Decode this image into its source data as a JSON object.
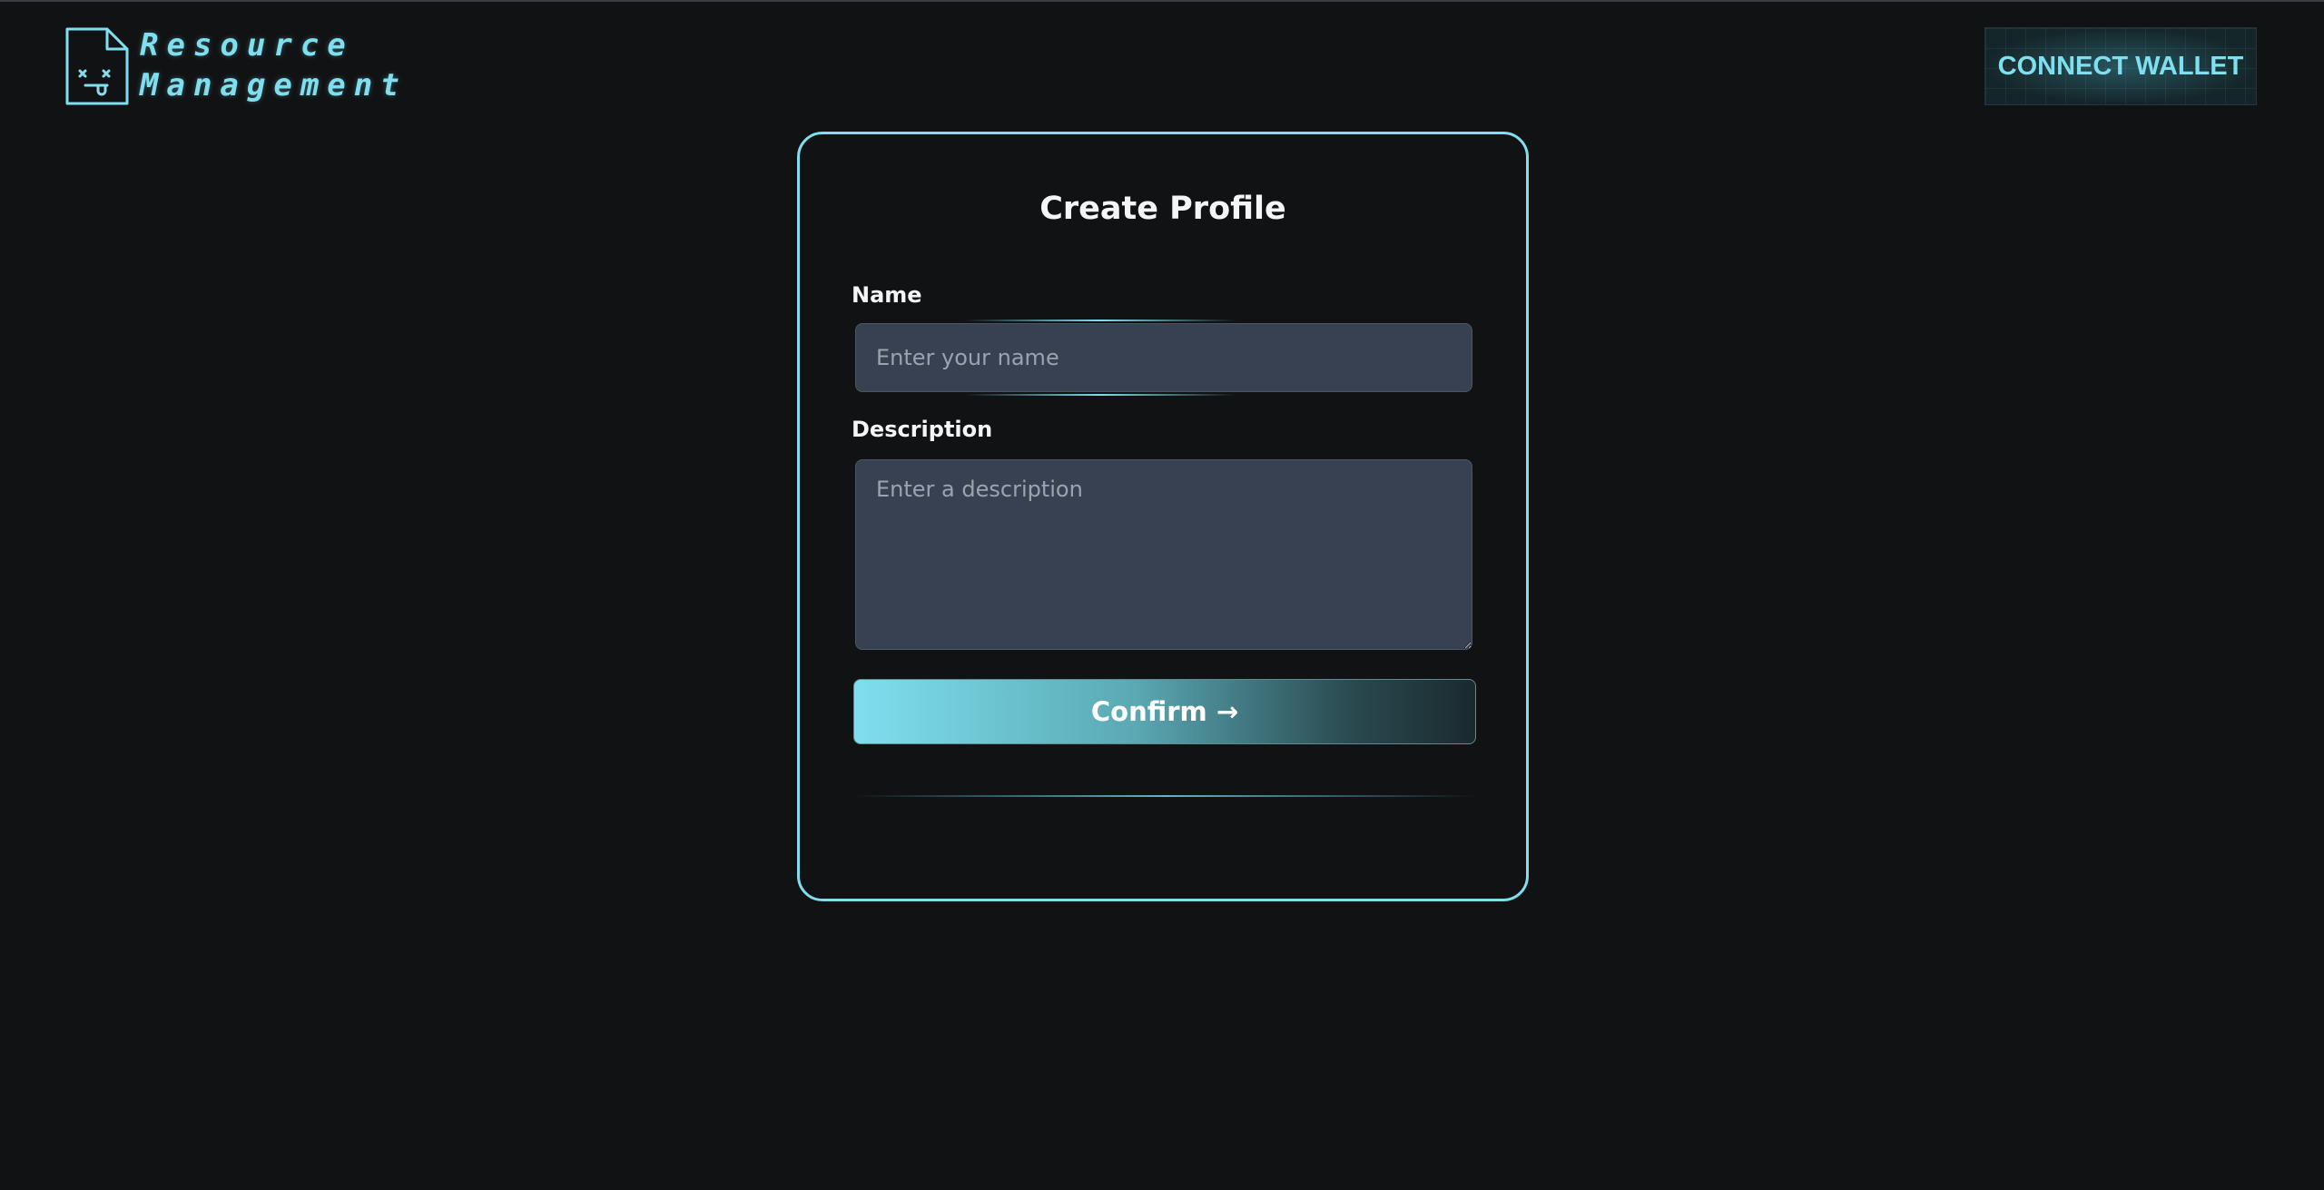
{
  "header": {
    "logo_line1": "Resource",
    "logo_line2": "Management",
    "logo_icon": "file-dead-face-icon",
    "connect_label": "CONNECT WALLET"
  },
  "form": {
    "title": "Create Profile",
    "name_label": "Name",
    "name_placeholder": "Enter your name",
    "name_value": "",
    "description_label": "Description",
    "description_placeholder": "Enter a description",
    "description_value": "",
    "confirm_label": "Confirm →"
  },
  "colors": {
    "background": "#111214",
    "accent": "#7fdfee",
    "field_bg": "#374151"
  }
}
